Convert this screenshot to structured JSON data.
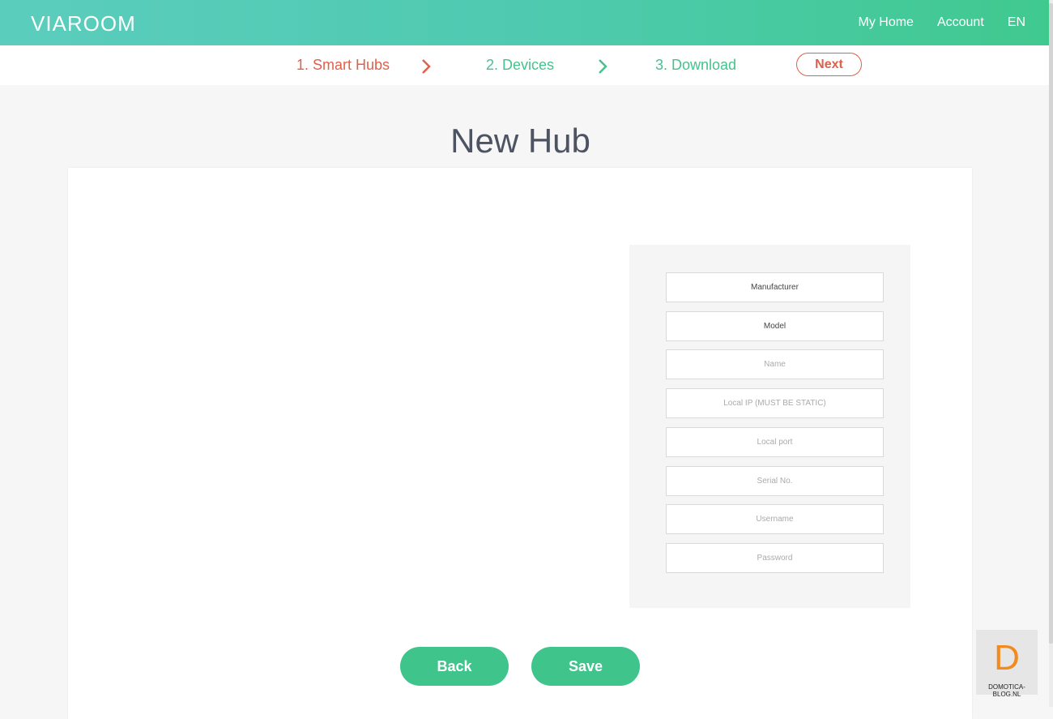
{
  "header": {
    "logo": "VIAROOM",
    "nav": [
      "My Home",
      "Account",
      "EN"
    ]
  },
  "steps": {
    "items": [
      "1. Smart Hubs",
      "2. Devices",
      "3. Download"
    ],
    "active_index": 0,
    "next_label": "Next"
  },
  "page": {
    "title": "New Hub"
  },
  "form": {
    "manufacturer": "Manufacturer",
    "model": "Model",
    "name_placeholder": "Name",
    "local_ip_placeholder": "Local IP (MUST BE STATIC)",
    "local_port_placeholder": "Local port",
    "serial_placeholder": "Serial No.",
    "username_placeholder": "Username",
    "password_placeholder": "Password"
  },
  "actions": {
    "back_label": "Back",
    "save_label": "Save"
  },
  "watermark": {
    "letter": "D",
    "text": "DOMOTICA-BLOG.NL"
  },
  "colors": {
    "header_gradient_start": "#5bcdbd",
    "header_gradient_end": "#40c98f",
    "accent_green": "#3fc48b",
    "active_step": "#e0604b",
    "todo_step": "#47c18e",
    "title_text": "#4d5360",
    "watermark_orange": "#f28a1e"
  }
}
